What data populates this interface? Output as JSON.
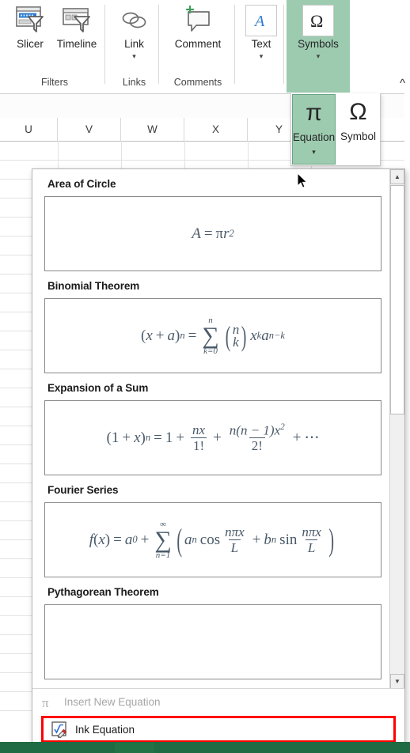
{
  "ribbon": {
    "groups": [
      {
        "label": "Filters",
        "buttons": [
          {
            "label": "Slicer",
            "icon": "slicer-icon",
            "has_chevron": false
          },
          {
            "label": "Timeline",
            "icon": "timeline-icon",
            "has_chevron": false
          }
        ]
      },
      {
        "label": "Links",
        "buttons": [
          {
            "label": "Link",
            "icon": "link-icon",
            "has_chevron": true
          }
        ]
      },
      {
        "label": "Comments",
        "buttons": [
          {
            "label": "Comment",
            "icon": "comment-icon",
            "has_chevron": false
          }
        ]
      },
      {
        "label": "",
        "buttons": [
          {
            "label": "Text",
            "icon": "text-icon",
            "has_chevron": true
          }
        ]
      },
      {
        "label": "",
        "buttons": [
          {
            "label": "Symbols",
            "icon": "omega-icon",
            "has_chevron": true
          }
        ]
      }
    ],
    "collapse_icon": "chevron-up-icon",
    "highlight_color": "#9dcbb0"
  },
  "symbols_dropdown": {
    "equation": {
      "label": "Equation",
      "icon": "pi-icon",
      "chevron": "chevron-down-icon",
      "selected": true
    },
    "symbol": {
      "label": "Symbol",
      "icon": "omega-icon",
      "selected": false
    }
  },
  "sheet": {
    "column_headers": [
      "U",
      "V",
      "W",
      "X",
      "Y"
    ]
  },
  "gallery": {
    "items": [
      {
        "title": "Area of Circle",
        "equation": "A = πr²"
      },
      {
        "title": "Binomial Theorem",
        "equation": "(x + a)ⁿ = Σₖ₌₀ⁿ (n k) xᵏ aⁿ⁻ᵏ"
      },
      {
        "title": "Expansion of a Sum",
        "equation": "(1 + x)ⁿ = 1 + nx/1! + n(n − 1)x²/2! + ⋯"
      },
      {
        "title": "Fourier Series",
        "equation": "f(x) = a₀ + Σₙ₌₁^∞ (aₙ cos nπx/L + bₙ sin nπx/L)"
      },
      {
        "title": "Pythagorean Theorem",
        "equation": ""
      }
    ],
    "math": {
      "area": {
        "A": "A",
        "eq": "=",
        "pi": "π",
        "r": "r",
        "exp2": "2"
      },
      "binomial": {
        "lhs_open": "(",
        "x": "x",
        "plus": "+",
        "a": "a",
        "lhs_close": ")",
        "n_exp": "n",
        "eq": "=",
        "sigma": "∑",
        "upper": "n",
        "lower": "k=0",
        "bin_top": "n",
        "bin_bot": "k",
        "x2": "x",
        "k_exp": "k",
        "a2": "a",
        "nk_exp": "n−k"
      },
      "expansion": {
        "open": "(",
        "one": "1",
        "plus": "+",
        "x": "x",
        "close": ")",
        "n_exp": "n",
        "eq": "=",
        "one2": "1",
        "plus2": "+",
        "f1_num": "nx",
        "f1_den": "1!",
        "plus3": "+",
        "f2_num_a": "n(n − 1)x",
        "f2_num_sup": "2",
        "f2_den": "2!",
        "plus4": "+",
        "dots": "⋯"
      },
      "fourier": {
        "f": "f",
        "open1": "(",
        "x": "x",
        "close1": ")",
        "eq": "=",
        "a": "a",
        "a_sub": "0",
        "plus": "+",
        "sigma": "∑",
        "upper": "∞",
        "lower": "n=1",
        "popen": "(",
        "an": "a",
        "an_sub": "n",
        "cos": "cos",
        "f1_num": "nπx",
        "f1_den": "L",
        "plus2": "+",
        "bn": "b",
        "bn_sub": "n",
        "sin": "sin",
        "f2_num": "nπx",
        "f2_den": "L",
        "pclose": ")"
      }
    },
    "scrollbar": {
      "up_arrow": "scroll-up-icon",
      "down_arrow": "scroll-down-icon",
      "thumb": "scroll-thumb"
    },
    "footer": {
      "insert_new": {
        "label": "Insert New Equation",
        "accel": "I",
        "icon": "pi-icon",
        "enabled": false
      },
      "ink": {
        "label": "Ink Equation",
        "accel": "k",
        "icon": "ink-equation-icon",
        "enabled": true,
        "highlight_color": "#ff0000"
      }
    }
  }
}
